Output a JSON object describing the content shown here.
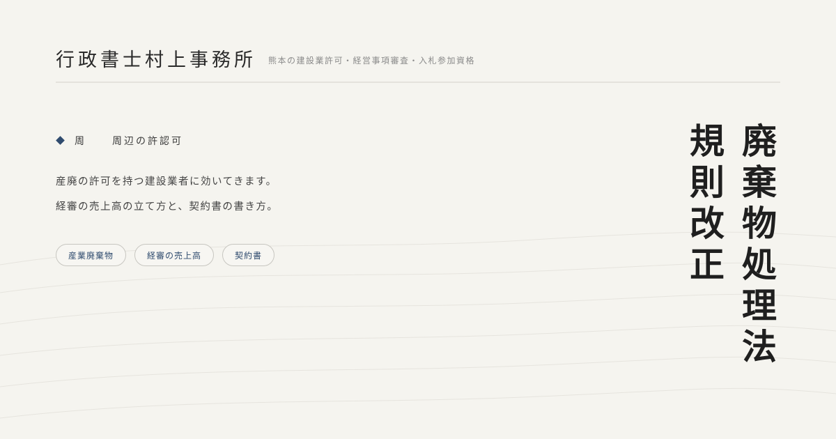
{
  "header": {
    "office_name": "行政書士村上事務所",
    "tagline": "熊本の建設業許可・経営事項審査・入札参加資格"
  },
  "category": {
    "short": "周",
    "label": "周辺の許認可"
  },
  "description": {
    "line1": "産廃の許可を持つ建設業者に効いてきます。",
    "line2": "経審の売上高の立て方と、契約書の書き方。"
  },
  "tags": [
    "産業廃棄物",
    "経審の売上高",
    "契約書"
  ],
  "title": {
    "line1": "廃棄物処理法",
    "line2": "規則改正"
  },
  "colors": {
    "background": "#f5f4ef",
    "accent": "#2f4b6e",
    "text": "#333333"
  }
}
